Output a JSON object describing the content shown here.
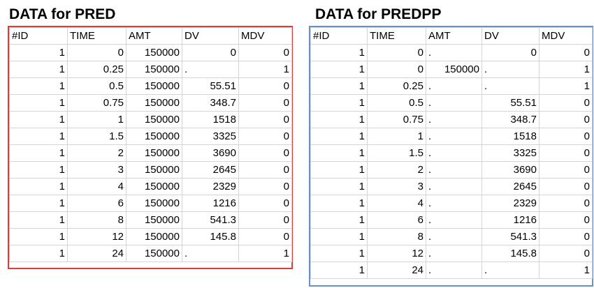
{
  "pred": {
    "title": "DATA for PRED",
    "headers": [
      "#ID",
      "TIME",
      "AMT",
      "DV",
      "MDV"
    ],
    "rows": [
      [
        "1",
        "0",
        "150000",
        "0",
        "0"
      ],
      [
        "1",
        "0.25",
        "150000",
        ".",
        "1"
      ],
      [
        "1",
        "0.5",
        "150000",
        "55.51",
        "0"
      ],
      [
        "1",
        "0.75",
        "150000",
        "348.7",
        "0"
      ],
      [
        "1",
        "1",
        "150000",
        "1518",
        "0"
      ],
      [
        "1",
        "1.5",
        "150000",
        "3325",
        "0"
      ],
      [
        "1",
        "2",
        "150000",
        "3690",
        "0"
      ],
      [
        "1",
        "3",
        "150000",
        "2645",
        "0"
      ],
      [
        "1",
        "4",
        "150000",
        "2329",
        "0"
      ],
      [
        "1",
        "6",
        "150000",
        "1216",
        "0"
      ],
      [
        "1",
        "8",
        "150000",
        "541.3",
        "0"
      ],
      [
        "1",
        "12",
        "150000",
        "145.8",
        "0"
      ],
      [
        "1",
        "24",
        "150000",
        ".",
        "1"
      ]
    ]
  },
  "predpp": {
    "title": "DATA for PREDPP",
    "headers": [
      "#ID",
      "TIME",
      "AMT",
      "DV",
      "MDV"
    ],
    "rows": [
      [
        "1",
        "0",
        ".",
        "0",
        "0"
      ],
      [
        "1",
        "0",
        "150000",
        ".",
        "1"
      ],
      [
        "1",
        "0.25",
        ".",
        ".",
        "1"
      ],
      [
        "1",
        "0.5",
        ".",
        "55.51",
        "0"
      ],
      [
        "1",
        "0.75",
        ".",
        "348.7",
        "0"
      ],
      [
        "1",
        "1",
        ".",
        "1518",
        "0"
      ],
      [
        "1",
        "1.5",
        ".",
        "3325",
        "0"
      ],
      [
        "1",
        "2",
        ".",
        "3690",
        "0"
      ],
      [
        "1",
        "3",
        ".",
        "2645",
        "0"
      ],
      [
        "1",
        "4",
        ".",
        "2329",
        "0"
      ],
      [
        "1",
        "6",
        ".",
        "1216",
        "0"
      ],
      [
        "1",
        "8",
        ".",
        "541.3",
        "0"
      ],
      [
        "1",
        "12",
        ".",
        "145.8",
        "0"
      ],
      [
        "1",
        "24",
        ".",
        ".",
        "1"
      ]
    ]
  },
  "colors": {
    "pred_border": "#e03a3a",
    "predpp_border": "#6a8fc4",
    "grid_line": "#d4d4d4"
  }
}
